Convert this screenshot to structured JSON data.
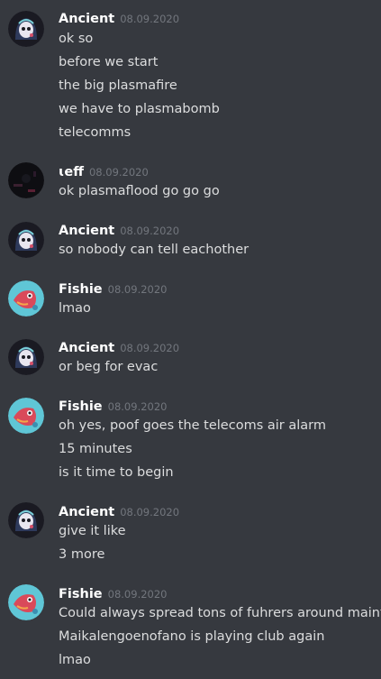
{
  "messages": [
    {
      "author": "Ancient",
      "timestamp": "08.09.2020",
      "avatar": "hooded-skull-avatar",
      "lines": [
        "ok so",
        "before we start",
        "the big plasmafire",
        "we have to plasmabomb",
        "telecomms"
      ]
    },
    {
      "author": "ɩeff",
      "timestamp": "08.09.2020",
      "avatar": "dark-avatar",
      "lines": [
        "ok plasmaflood go go go"
      ]
    },
    {
      "author": "Ancient",
      "timestamp": "08.09.2020",
      "avatar": "hooded-skull-avatar",
      "lines": [
        "so nobody can tell eachother"
      ]
    },
    {
      "author": "Fishie",
      "timestamp": "08.09.2020",
      "avatar": "fish-avatar",
      "lines": [
        "lmao"
      ]
    },
    {
      "author": "Ancient",
      "timestamp": "08.09.2020",
      "avatar": "hooded-skull-avatar",
      "lines": [
        "or beg for evac"
      ]
    },
    {
      "author": "Fishie",
      "timestamp": "08.09.2020",
      "avatar": "fish-avatar",
      "lines": [
        "oh yes, poof goes the telecoms air alarm",
        "15 minutes",
        "is it time to begin"
      ]
    },
    {
      "author": "Ancient",
      "timestamp": "08.09.2020",
      "avatar": "hooded-skull-avatar",
      "lines": [
        "give it like",
        "3 more"
      ]
    },
    {
      "author": "Fishie",
      "timestamp": "08.09.2020",
      "avatar": "fish-avatar",
      "lines": [
        "Could always spread tons of fuhrers around maint",
        "Maikalengoenofano is playing club again",
        "lmao"
      ]
    }
  ]
}
